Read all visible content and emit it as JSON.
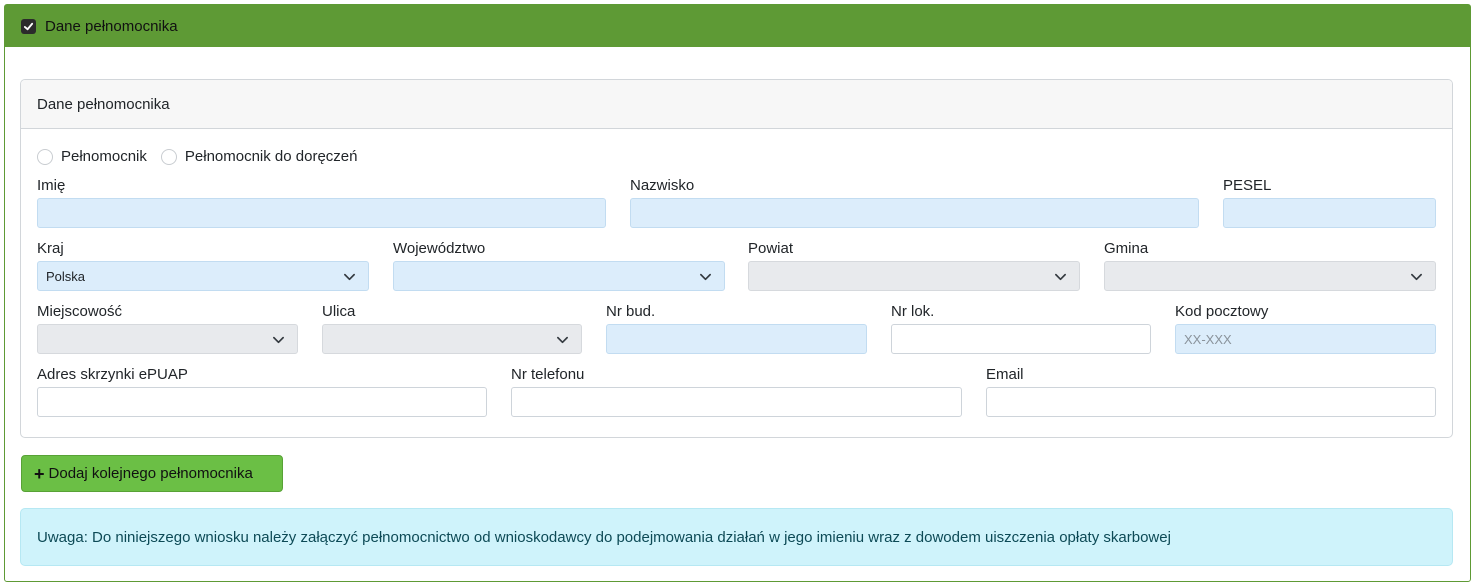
{
  "section": {
    "title": "Dane pełnomocnika",
    "checkbox_checked": true,
    "accent_color": "#5e9a35"
  },
  "card": {
    "title": "Dane pełnomocnika",
    "radio_options": [
      "Pełnomocnik",
      "Pełnomocnik do doręczeń"
    ],
    "fields": {
      "imie": {
        "label": "Imię",
        "value": ""
      },
      "nazwisko": {
        "label": "Nazwisko",
        "value": ""
      },
      "pesel": {
        "label": "PESEL",
        "value": ""
      },
      "kraj": {
        "label": "Kraj",
        "value": "Polska"
      },
      "wojewodztwo": {
        "label": "Województwo",
        "value": ""
      },
      "powiat": {
        "label": "Powiat",
        "value": ""
      },
      "gmina": {
        "label": "Gmina",
        "value": ""
      },
      "miejscowosc": {
        "label": "Miejscowość",
        "value": ""
      },
      "ulica": {
        "label": "Ulica",
        "value": ""
      },
      "nr_bud": {
        "label": "Nr bud.",
        "value": ""
      },
      "nr_lok": {
        "label": "Nr lok.",
        "value": ""
      },
      "kod_pocztowy": {
        "label": "Kod pocztowy",
        "placeholder": "XX-XXX"
      },
      "epuap": {
        "label": "Adres skrzynki ePUAP",
        "value": ""
      },
      "telefon": {
        "label": "Nr telefonu",
        "value": ""
      },
      "email": {
        "label": "Email",
        "value": ""
      }
    }
  },
  "add_button": {
    "label": "Dodaj kolejnego pełnomocnika",
    "icon": "plus-icon"
  },
  "alert": {
    "text": "Uwaga: Do niniejszego wniosku należy załączyć pełnomocnictwo od wnioskodawcy do podejmowania działań w jego imieniu wraz z dowodem uiszczenia opłaty skarbowej"
  }
}
